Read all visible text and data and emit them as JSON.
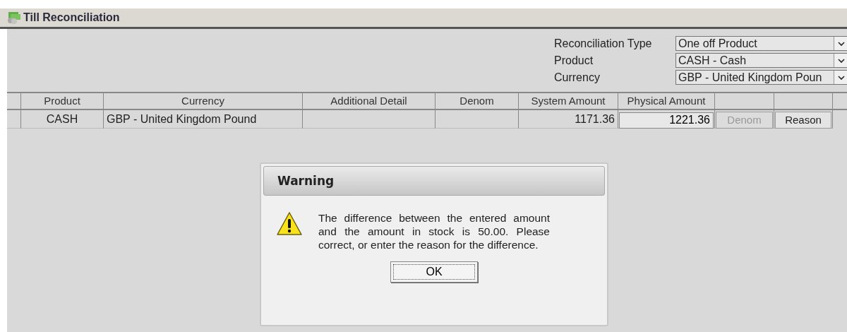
{
  "window": {
    "title": "Till Reconciliation"
  },
  "filters": [
    {
      "label": "Reconciliation Type",
      "value": "One off Product"
    },
    {
      "label": "Product",
      "value": "CASH - Cash"
    },
    {
      "label": "Currency",
      "value": "GBP - United Kingdom Poun"
    }
  ],
  "table": {
    "columns": [
      "",
      "Product",
      "Currency",
      "Additional Detail",
      "Denom",
      "System Amount",
      "Physical Amount",
      "",
      ""
    ],
    "rows": [
      {
        "product": "CASH",
        "currency": "GBP - United Kingdom Pound",
        "additional_detail": "",
        "denom": "",
        "system_amount": "1171.36",
        "physical_amount": "1221.36",
        "buttons": [
          {
            "label": "Denom",
            "disabled": true
          },
          {
            "label": "Reason",
            "disabled": false
          }
        ]
      }
    ]
  },
  "dialog": {
    "title": "Warning",
    "kind": "warning",
    "message": "The difference between the entered amount and the amount in stock is 50.00. Please correct, or enter the reason for the difference.",
    "button": "OK"
  }
}
